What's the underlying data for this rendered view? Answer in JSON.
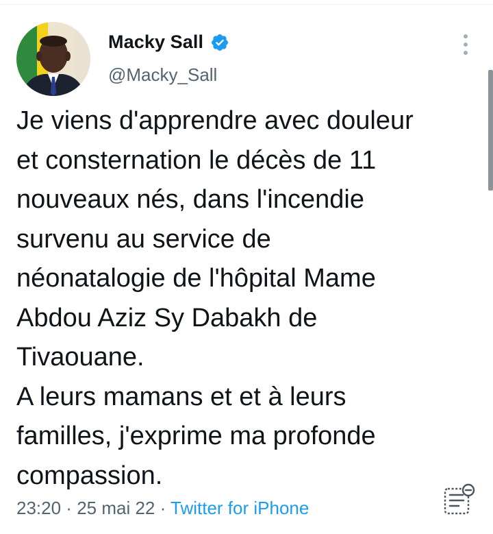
{
  "tweet": {
    "author": {
      "name": "Macky Sall",
      "handle": "@Macky_Sall",
      "verified": true
    },
    "text": "Je viens d'apprendre avec douleur\net consternation le décès de 11\nnouveaux nés, dans l'incendie\nsurvenu au service de\nnéonatalogie de l'hôpital Mame\nAbdou Aziz Sy Dabakh de\nTivaouane.\nA leurs mamans et et à leurs\nfamilles, j'exprime ma profonde\ncompassion.",
    "time": "23:20",
    "separator": " · ",
    "date": "25 mai 22",
    "source": "Twitter for iPhone"
  },
  "icons": {
    "verified": "verified-badge-icon",
    "more": "more-options-icon",
    "analytics": "tweet-analytics-icon"
  },
  "colors": {
    "text": "#0f1419",
    "secondary": "#536471",
    "link": "#1d9bf0",
    "verified": "#1d9bf0"
  }
}
